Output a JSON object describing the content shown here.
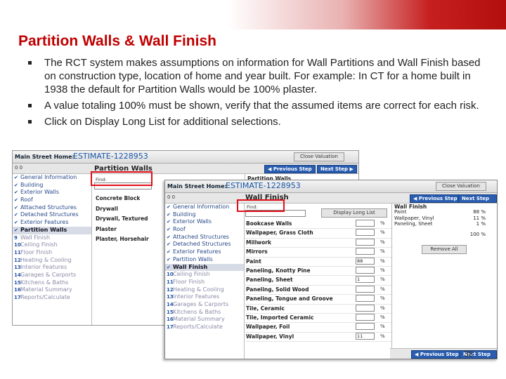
{
  "slide": {
    "title": "Partition Walls  & Wall Finish",
    "bullets": [
      "The RCT system makes assumptions on information for Wall Partitions and Wall Finish based on construction type, location of home and year built.  For example: In CT for a home built in 1938 the default for Partition Walls would be 100% plaster.",
      "A value totaling 100% must be shown, verify that the assumed items are correct for each risk.",
      "Click on Display Long List for additional selections."
    ],
    "page_number": "38"
  },
  "shot1": {
    "header_label": "Main Street Home:",
    "estimate": "ESTIMATE-1228953",
    "close_label": "Close Valuation",
    "counter": "0     0",
    "prev_label": "◀ Previous Step",
    "next_label": "Next Step ▶",
    "panel_title": "Partition Walls",
    "find_label": "Find:",
    "right_title": "Partition Walls",
    "list": [
      "Concrete Block",
      "Drywall",
      "Drywall, Textured",
      "Plaster",
      "Plaster, Horsehair"
    ]
  },
  "nav": [
    {
      "mark": "✔",
      "label": "General Information"
    },
    {
      "mark": "✔",
      "label": "Building"
    },
    {
      "mark": "✔",
      "label": "Exterior Walls"
    },
    {
      "mark": "✔",
      "label": "Roof"
    },
    {
      "mark": "✔",
      "label": "Attached Structures"
    },
    {
      "mark": "✔",
      "label": "Detached Structures"
    },
    {
      "mark": "✔",
      "label": "Exterior Features"
    },
    {
      "mark": "✔",
      "label": "Partition Walls"
    },
    {
      "mark": "9",
      "label": "Wall Finish"
    },
    {
      "mark": "10",
      "label": "Ceiling Finish"
    },
    {
      "mark": "11",
      "label": "Floor Finish"
    },
    {
      "mark": "12",
      "label": "Heating & Cooling"
    },
    {
      "mark": "13",
      "label": "Interior Features"
    },
    {
      "mark": "14",
      "label": "Garages & Carports"
    },
    {
      "mark": "15",
      "label": "Kitchens & Baths"
    },
    {
      "mark": "16",
      "label": "Material Summary"
    },
    {
      "mark": "17",
      "label": "Reports/Calculate"
    }
  ],
  "nav2": [
    {
      "mark": "✔",
      "label": "General Information"
    },
    {
      "mark": "✔",
      "label": "Building"
    },
    {
      "mark": "✔",
      "label": "Exterior Walls"
    },
    {
      "mark": "✔",
      "label": "Roof"
    },
    {
      "mark": "✔",
      "label": "Attached Structures"
    },
    {
      "mark": "✔",
      "label": "Detached Structures"
    },
    {
      "mark": "✔",
      "label": "Exterior Features"
    },
    {
      "mark": "✔",
      "label": "Partition Walls"
    },
    {
      "mark": "✔",
      "label": "Wall Finish"
    },
    {
      "mark": "10",
      "label": "Ceiling Finish"
    },
    {
      "mark": "11",
      "label": "Floor Finish"
    },
    {
      "mark": "12",
      "label": "Heating & Cooling"
    },
    {
      "mark": "13",
      "label": "Interior Features"
    },
    {
      "mark": "14",
      "label": "Garages & Carports"
    },
    {
      "mark": "15",
      "label": "Kitchens & Baths"
    },
    {
      "mark": "16",
      "label": "Material Summary"
    },
    {
      "mark": "17",
      "label": "Reports/Calculate"
    }
  ],
  "shot2": {
    "header_label": "Main Street Home:",
    "estimate": "ESTIMATE-1228953",
    "close_label": "Close Valuation",
    "counter": "0     0",
    "prev_label": "◀ Previous Step",
    "next_label": "Next Step ▶",
    "panel_title": "Wall Finish",
    "find_label": "Find:",
    "long_list_label": "Display Long List",
    "pct_symbol": "%",
    "rows": [
      {
        "label": "Bookcase Walls",
        "value": ""
      },
      {
        "label": "Wallpaper, Grass Cloth",
        "value": ""
      },
      {
        "label": "Millwork",
        "value": ""
      },
      {
        "label": "Mirrors",
        "value": ""
      },
      {
        "label": "Paint",
        "value": "88"
      },
      {
        "label": "Paneling, Knotty Pine",
        "value": ""
      },
      {
        "label": "Paneling, Sheet",
        "value": "1"
      },
      {
        "label": "Paneling, Solid Wood",
        "value": ""
      },
      {
        "label": "Paneling, Tongue and Groove",
        "value": ""
      },
      {
        "label": "Tile, Ceramic",
        "value": ""
      },
      {
        "label": "Tile, Imported Ceramic",
        "value": ""
      },
      {
        "label": "Wallpaper, Foil",
        "value": ""
      },
      {
        "label": "Wallpaper, Vinyl",
        "value": "11"
      }
    ],
    "summary_title": "Wall Finish",
    "summary": [
      {
        "label": "Paint",
        "pct": "88 %"
      },
      {
        "label": "Wallpaper, Vinyl",
        "pct": "11 %"
      },
      {
        "label": "Paneling, Sheet",
        "pct": "1 %"
      }
    ],
    "total": "100 %",
    "remove_label": "Remove All"
  },
  "colors": {
    "title": "#c00000",
    "accent": "#2a5db0",
    "highlight": "#e0101a"
  }
}
